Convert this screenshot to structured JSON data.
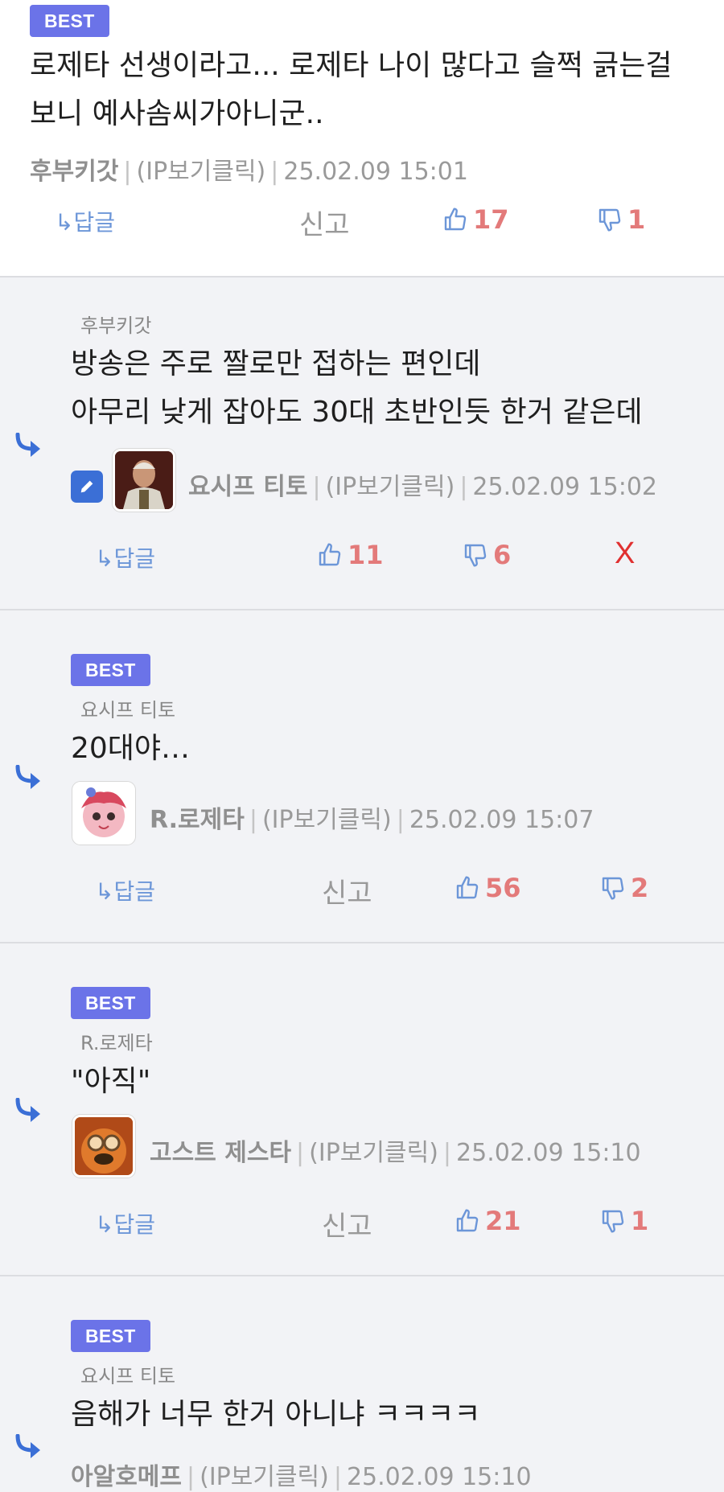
{
  "best_label": "BEST",
  "ip_label": "(IP보기클릭)",
  "reply_label": "↳답글",
  "report_label": "신고",
  "delete_label": "X",
  "comments": [
    {
      "lines": [
        "로제타 선생이라고... 로제타 나이 많다고 슬쩍 긁는걸",
        "보니 예사솜씨가아니군.."
      ],
      "author": "후부키갓",
      "time": "25.02.09 15:01",
      "likes": "17",
      "dislikes": "1"
    },
    {
      "parent": "후부키갓",
      "lines": [
        "방송은 주로 짤로만 접하는 편인데",
        "아무리 낮게 잡아도 30대 초반인듯 한거 같은데"
      ],
      "author": "요시프 티토",
      "time": "25.02.09 15:02",
      "likes": "11",
      "dislikes": "6"
    },
    {
      "parent": "요시프 티토",
      "lines": [
        "20대야…"
      ],
      "author": "R.로제타",
      "time": "25.02.09 15:07",
      "likes": "56",
      "dislikes": "2"
    },
    {
      "parent": "R.로제타",
      "lines": [
        "\"아직\""
      ],
      "author": "고스트 제스타",
      "time": "25.02.09 15:10",
      "likes": "21",
      "dislikes": "1"
    },
    {
      "parent": "요시프 티토",
      "lines": [
        "음해가 너무 한거 아니냐 ㅋㅋㅋㅋ"
      ],
      "author": "아알호메프",
      "time": "25.02.09 15:10"
    }
  ]
}
